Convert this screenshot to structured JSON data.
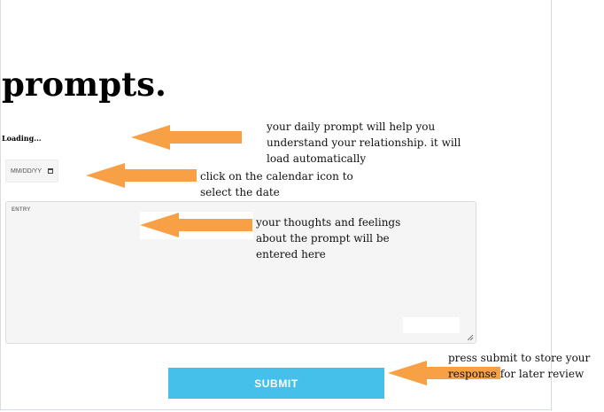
{
  "title": "prompts.",
  "loading_text": "Loading...",
  "date_input": {
    "placeholder": "MM/DD/YY"
  },
  "entry": {
    "label": "ENTRY"
  },
  "submit_label": "SUBMIT",
  "annotations": {
    "prompt_note": "your daily prompt will  help you\nunderstand your relationship. it will\nload automatically",
    "date_note": "click on the calendar icon to\nselect the date",
    "entry_note": "your thoughts and feelings\nabout the prompt will be\nentered here",
    "submit_note": "press submit to store your\nresponse for later review"
  },
  "colors": {
    "arrow": "#f7a046",
    "button": "#44c0ea",
    "field_bg": "#f5f5f5"
  },
  "icons": [
    "calendar-icon",
    "resize-grip-icon",
    "arrow-left-icon"
  ]
}
